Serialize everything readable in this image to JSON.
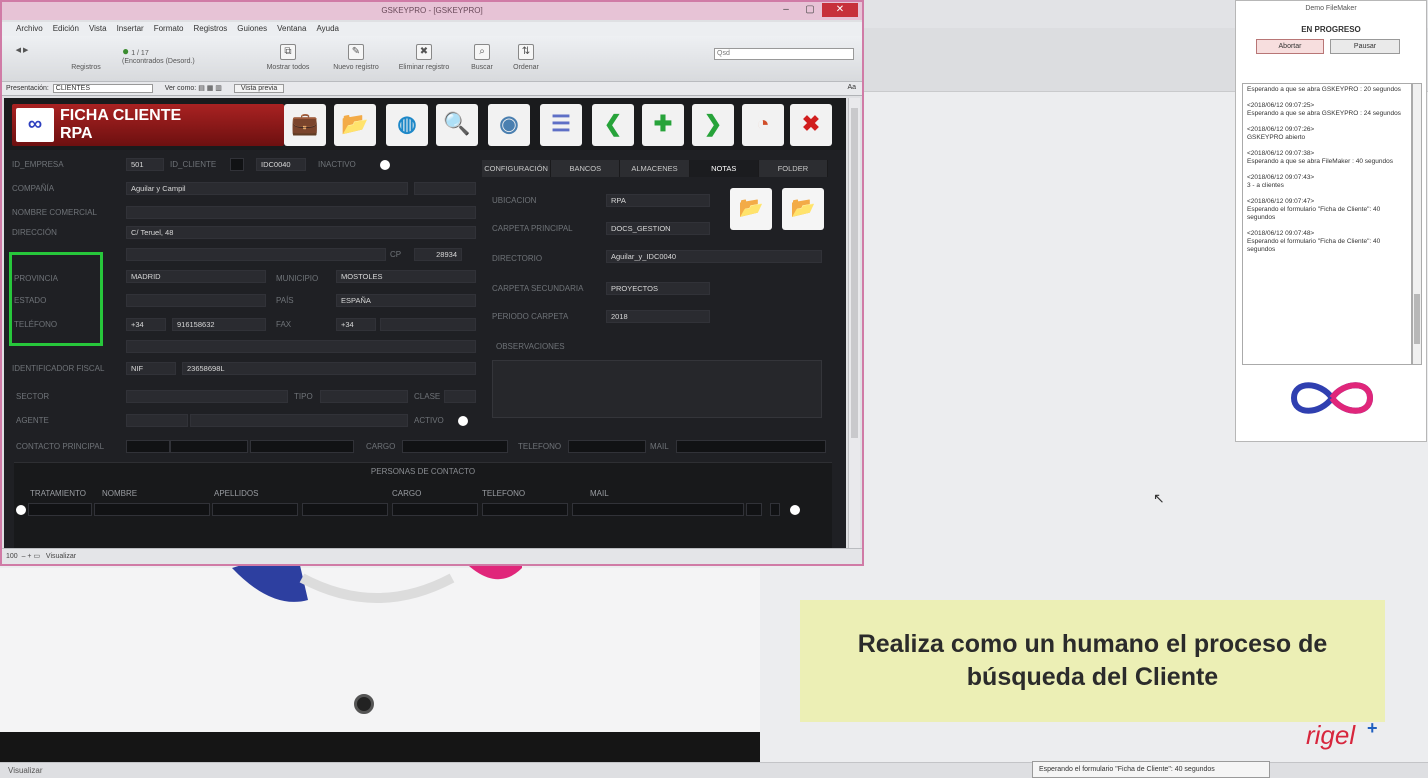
{
  "fm_window": {
    "title": "GSKEYPRO - [GSKEYPRO]",
    "menu": [
      "Archivo",
      "Edición",
      "Vista",
      "Insertar",
      "Formato",
      "Registros",
      "Guiones",
      "Ventana",
      "Ayuda"
    ],
    "toolbar": {
      "records_label": "Registros",
      "record_count": "1 / 17",
      "record_status": "(Encontrados (Desord.)",
      "items": [
        "Mostrar todos",
        "Nuevo registro",
        "Eliminar registro",
        "Buscar",
        "Ordenar"
      ],
      "search_placeholder": "Qsd"
    },
    "layout_bar": {
      "presentation_label": "Presentación:",
      "presentation_value": "CLIENTES",
      "view_label": "Ver como:",
      "preview_label": "Vista previa",
      "aa": "Aa"
    },
    "status_bar": {
      "zoom": "100",
      "mode": "Visualizar"
    }
  },
  "form": {
    "title_line1": "FICHA CLIENTE",
    "title_line2": "RPA",
    "logo_glyph": "∞",
    "header_buttons": [
      {
        "name": "briefcase-icon",
        "glyph": "💼",
        "color": "#8a4a1a"
      },
      {
        "name": "folder-icon",
        "glyph": "📂",
        "color": "#d4a017"
      },
      {
        "name": "refresh-icon",
        "glyph": "◍",
        "color": "#1e88c8"
      },
      {
        "name": "search-icon",
        "glyph": "🔍",
        "color": "#1e88c8"
      },
      {
        "name": "map-icon",
        "glyph": "◉",
        "color": "#4a7fb0"
      },
      {
        "name": "list-icon",
        "glyph": "☰",
        "color": "#5e6fc6"
      },
      {
        "name": "chevron-left-icon",
        "glyph": "❮",
        "color": "#27a33a"
      },
      {
        "name": "add-icon",
        "glyph": "✚",
        "color": "#27a33a"
      },
      {
        "name": "chevron-right-icon",
        "glyph": "❯",
        "color": "#27a33a"
      },
      {
        "name": "chart-icon",
        "glyph": "◔",
        "color": "#d14e2a"
      },
      {
        "name": "close-icon",
        "glyph": "✖",
        "color": "#d11e1e"
      }
    ],
    "labels": {
      "id_empresa": "ID_EMPRESA",
      "id_cliente": "ID_CLIENTE",
      "inactivo": "INACTIVO",
      "compania": "COMPAÑÍA",
      "nombre_comercial": "NOMBRE COMERCIAL",
      "direccion": "DIRECCIÓN",
      "cp": "CP",
      "provincia": "PROVINCIA",
      "municipio": "MUNICIPIO",
      "estado": "ESTADO",
      "pais": "PAÍS",
      "telefono": "TELÉFONO",
      "fax": "FAX",
      "identificador_fiscal": "IDENTIFICADOR FISCAL",
      "sector": "SECTOR",
      "tipo": "TIPO",
      "clase": "CLASE",
      "agente": "AGENTE",
      "activo": "ACTIVO",
      "contacto_principal": "CONTACTO PRINCIPAL",
      "cargo": "CARGO",
      "telefono2": "TELEFONO",
      "mail": "MAIL"
    },
    "values": {
      "id_empresa": "501",
      "id_cliente": "IDC0040",
      "compania": "Aguilar y Campil",
      "direccion": "C/ Teruel, 48",
      "cp": "28934",
      "provincia": "MADRID",
      "municipio": "MOSTOLES",
      "pais": "ESPAÑA",
      "tel_prefix": "+34",
      "telefono": "916158632",
      "fax_prefix": "+34",
      "nif_label": "NIF",
      "nif": "23658698L"
    },
    "tabs": [
      "CONFIGURACIÓN",
      "BANCOS",
      "ALMACENES",
      "NOTAS",
      "FOLDER"
    ],
    "config": {
      "ubicacion_label": "UBICACION",
      "ubicacion": "RPA",
      "carpeta_principal_label": "CARPETA PRINCIPAL",
      "carpeta_principal": "DOCS_GESTION",
      "directorio_label": "DIRECTORIO",
      "directorio": "Aguilar_y_IDC0040",
      "carpeta_secundaria_label": "CARPETA SECUNDARIA",
      "carpeta_secundaria": "PROYECTOS",
      "periodo_label": "PERIODO CARPETA",
      "periodo": "2018",
      "observaciones_label": "OBSERVACIONES"
    },
    "contacts": {
      "title": "PERSONAS DE CONTACTO",
      "columns": [
        "TRATAMIENTO",
        "NOMBRE",
        "APELLIDOS",
        "CARGO",
        "TELEFONO",
        "MAIL"
      ]
    }
  },
  "panel": {
    "title": "Demo FileMaker",
    "status": "EN PROGRESO",
    "abort_label": "Abortar",
    "pause_label": "Pausar",
    "log": [
      "Esperando a que se abra GSKEYPRO : 20 segundos",
      "<2018/06/12 09:07:25>\nEsperando a que se abra GSKEYPRO : 24 segundos",
      "<2018/06/12 09:07:26>\nGSKEYPRO abierto",
      "<2018/06/12 09:07:38>\nEsperando a que se abra FileMaker : 40 segundos",
      "<2018/06/12 09:07:43>\n3 - a clientes",
      "<2018/06/12 09:07:47>\nEsperando el formulario \"Ficha de Cliente\": 40 segundos",
      "<2018/06/12 09:07:48>\nEsperando el formulario \"Ficha de Cliente\": 40 segundos"
    ]
  },
  "caption": "Realiza como un humano el proceso de búsqueda del Cliente",
  "brand": "rigel",
  "brand_plus": "+",
  "tooltip": "Esperando el formulario \"Ficha de Cliente\": 40 segundos",
  "bg_status": "Visualizar",
  "colors": {
    "highlight": "#27c73b",
    "caption_bg": "#ecefb5",
    "header_red": "#a92222",
    "window_border": "#d07ba6"
  }
}
